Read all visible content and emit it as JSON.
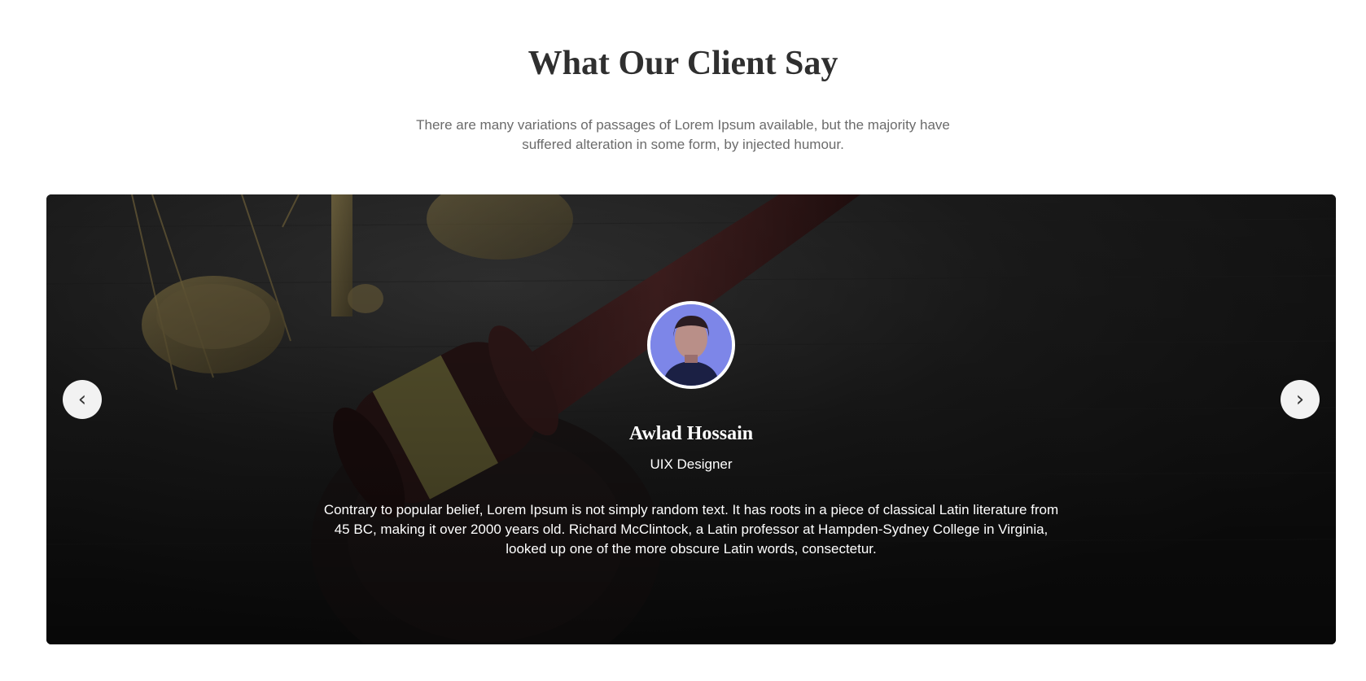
{
  "section": {
    "title": "What Our Client Say",
    "subtitle": "There are many variations of passages of Lorem Ipsum available, but the majority have suffered alteration in some form, by injected humour."
  },
  "testimonial": {
    "name": "Awlad Hossain",
    "role": "UIX Designer",
    "quote": "Contrary to popular belief, Lorem Ipsum is not simply random text. It has roots in a piece of classical Latin literature from 45 BC, making it over 2000 years old. Richard McClintock, a Latin professor at Hampden-Sydney College in Virginia, looked up one of the more obscure Latin words, consectetur."
  },
  "controls": {
    "prev_icon": "‹",
    "next_icon": "›"
  },
  "colors": {
    "title": "#2f2f2f",
    "subtitle": "#6b6b6b",
    "slider_bg": "#151515",
    "nav_button": "#f2f2f2"
  }
}
